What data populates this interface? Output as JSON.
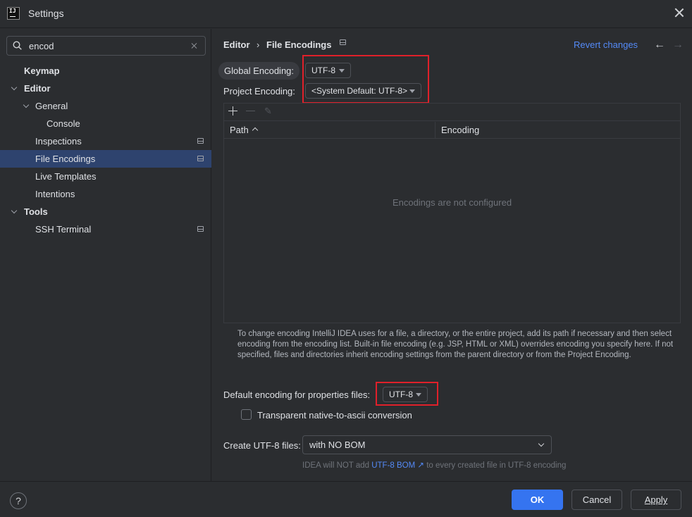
{
  "window": {
    "title": "Settings",
    "app_icon_text": "IJ"
  },
  "search": {
    "value": "encod",
    "placeholder": ""
  },
  "tree": [
    {
      "label": "Keymap"
    },
    {
      "label": "Editor"
    },
    {
      "label": "General"
    },
    {
      "label": "Console"
    },
    {
      "label": "Inspections"
    },
    {
      "label": "File Encodings"
    },
    {
      "label": "Live Templates"
    },
    {
      "label": "Intentions"
    },
    {
      "label": "Tools"
    },
    {
      "label": "SSH Terminal"
    }
  ],
  "header": {
    "crumb_parent": "Editor",
    "crumb_sep": "›",
    "crumb_current": "File Encodings",
    "revert": "Revert changes",
    "back": "←",
    "forward": "→"
  },
  "encoding": {
    "global_label": "Global Encoding:",
    "global_value": "UTF-8",
    "project_label": "Project Encoding:",
    "project_value": "<System Default: UTF-8>"
  },
  "table": {
    "columns": [
      "Path",
      "Encoding"
    ],
    "empty": "Encodings are not configured",
    "edit_glyph": "✎"
  },
  "info": "To change encoding IntelliJ IDEA uses for a file, a directory, or the entire project, add its path if necessary and then select encoding from the encoding list. Built-in file encoding (e.g. JSP, HTML or XML) overrides encoding you specify here. If not specified, files and directories inherit encoding settings from the parent directory or from the Project Encoding.",
  "properties": {
    "label": "Default encoding for properties files:",
    "value": "UTF-8",
    "checkbox_label": "Transparent native-to-ascii conversion",
    "checkbox_checked": false
  },
  "utf8": {
    "label": "Create UTF-8 files:",
    "value": "with NO BOM",
    "hint_prefix": "IDEA will NOT add",
    "hint_link": "UTF-8 BOM ↗",
    "hint_suffix": "to every created file in UTF-8 encoding"
  },
  "footer": {
    "help": "?",
    "ok": "OK",
    "cancel": "Cancel",
    "apply": "Apply"
  },
  "colors": {
    "accent": "#3574f0",
    "link": "#548af7",
    "highlight": "#e0202a",
    "selection": "#2e436e"
  }
}
